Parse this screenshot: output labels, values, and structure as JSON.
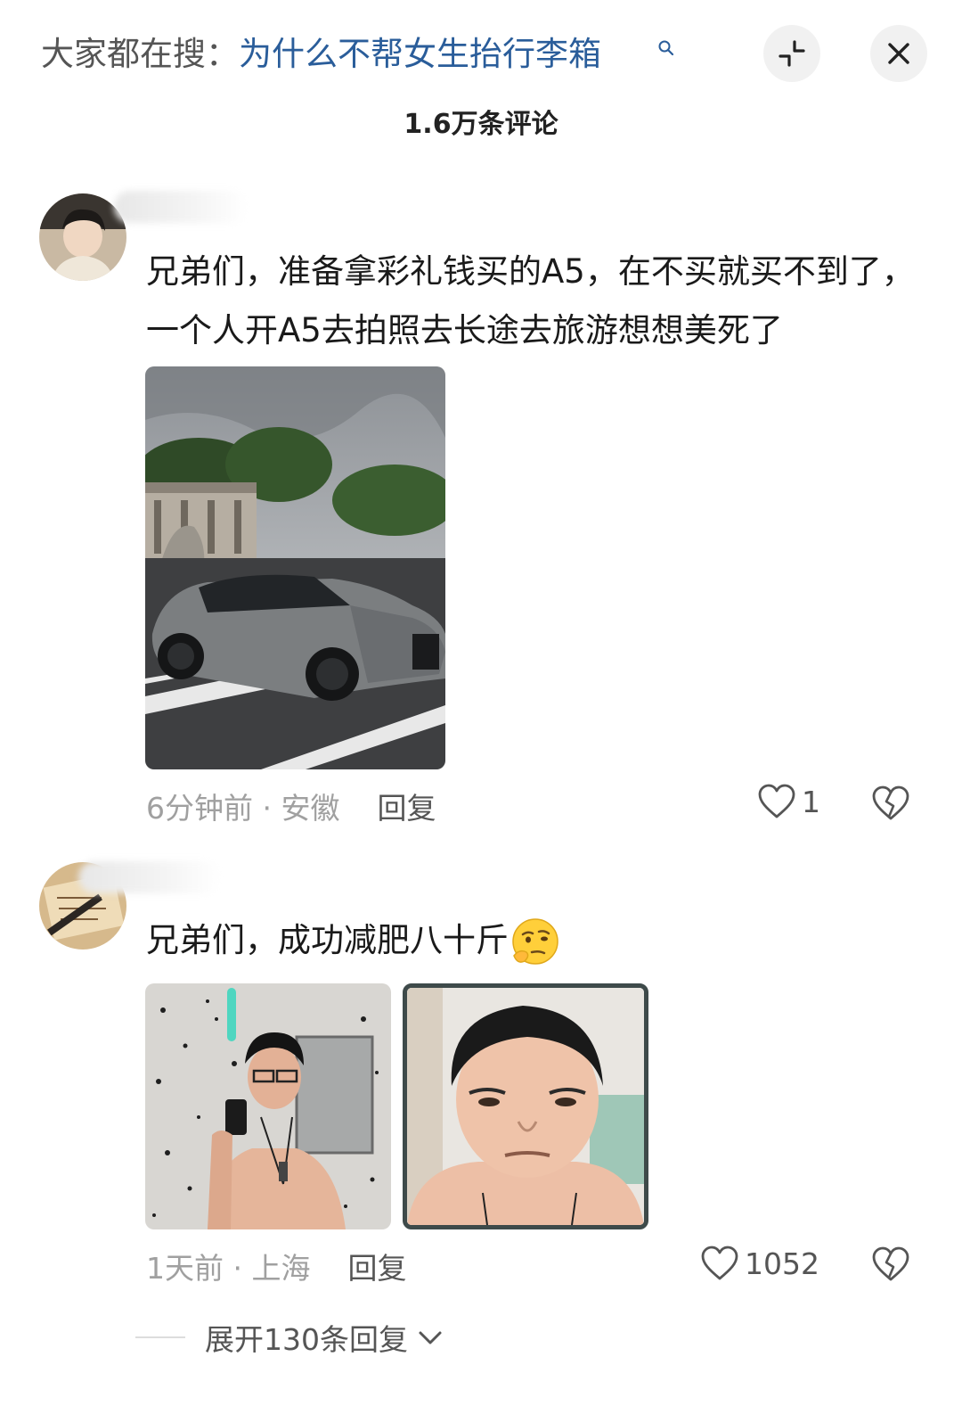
{
  "header": {
    "search_prefix": "大家都在搜：",
    "search_query": "为什么不帮女生抬行李箱",
    "collapse_icon": "collapse-icon",
    "close_icon": "close-icon"
  },
  "comment_count": "1.6万条评论",
  "comments": [
    {
      "text": "兄弟们，准备拿彩礼钱买的A5，在不买就买不到了，一个人开A5去拍照去长途去旅游想想美死了",
      "time": "6分钟前 · 安徽",
      "reply_label": "回复",
      "likes": "1"
    },
    {
      "text": "兄弟们，成功减肥八十斤",
      "emoji": "thinking-face-emoji",
      "time": "1天前 · 上海",
      "reply_label": "回复",
      "likes": "1052"
    }
  ],
  "expand_replies": "展开130条回复",
  "colors": {
    "link": "#2a5d9a",
    "meta": "#a0a0a0",
    "text": "#1a1a1a"
  }
}
